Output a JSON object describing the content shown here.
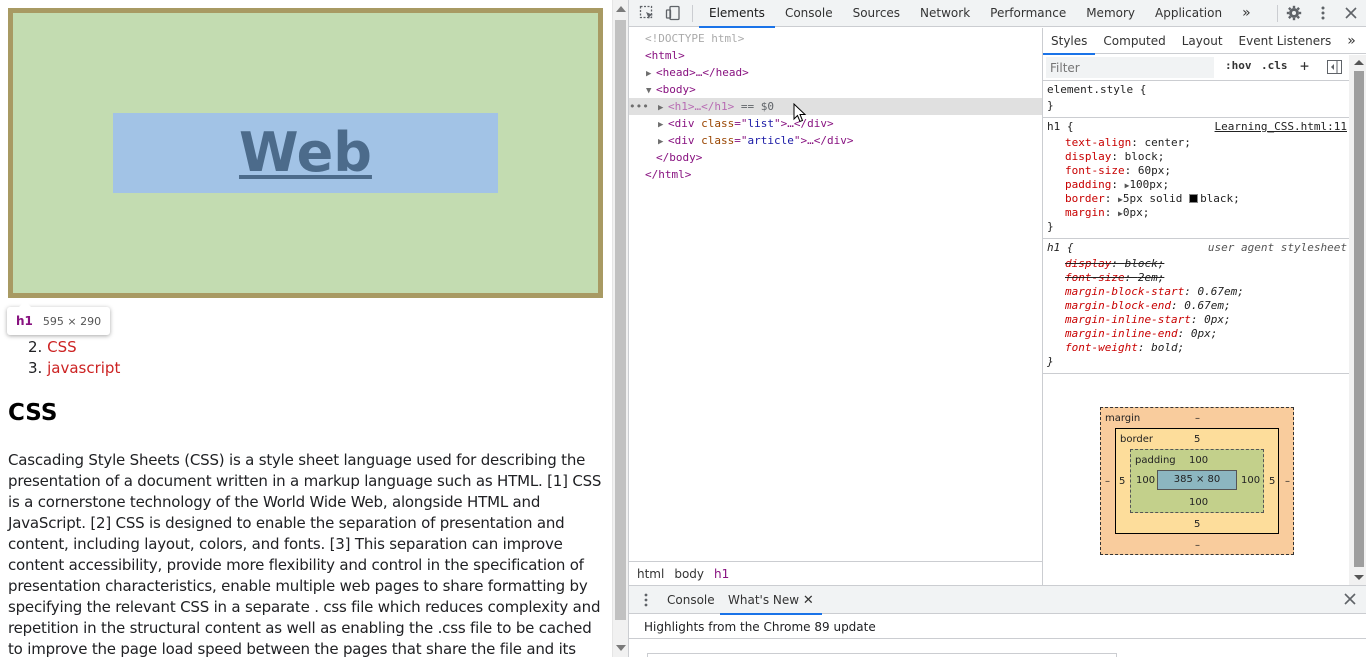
{
  "page": {
    "h1_text": "Web",
    "tooltip": {
      "tag": "h1",
      "dims": "595 × 290"
    },
    "list_items": [
      {
        "num": "2.",
        "label": "CSS"
      },
      {
        "num": "3.",
        "label": "javascript"
      }
    ],
    "article_heading": "CSS",
    "article_text": "Cascading Style Sheets (CSS) is a style sheet language used for describing the presentation of a document written in a markup language such as HTML. [1] CSS is a cornerstone technology of the World Wide Web, alongside HTML and JavaScript. [2] CSS is designed to enable the separation of presentation and content, including layout, colors, and fonts. [3] This separation can improve content accessibility, provide more flexibility and control in the specification of presentation characteristics, enable multiple web pages to share formatting by specifying the relevant CSS in a separate . css file which reduces complexity and repetition in the structural content as well as enabling the .css file to be cached to improve the page load speed between the pages that share the file and its"
  },
  "devtools": {
    "tabs": [
      "Elements",
      "Console",
      "Sources",
      "Network",
      "Performance",
      "Memory",
      "Application"
    ],
    "more_tabs": "»",
    "dom": {
      "doctype": "<!DOCTYPE html>",
      "html_open": "<html>",
      "head": "…</head>",
      "body_open": "<body>",
      "h1_line": "…</h1>",
      "h1_eq": "== $0",
      "div_list_class": "list",
      "div_article_class": "article",
      "body_close": "</body>",
      "html_close": "</html>",
      "dots": "•••"
    },
    "breadcrumb": [
      "html",
      "body",
      "h1"
    ],
    "styles_tabs": [
      "Styles",
      "Computed",
      "Layout",
      "Event Listeners",
      "»"
    ],
    "filter_placeholder": "Filter",
    "hov": ":hov",
    "cls": ".cls",
    "rules": {
      "element_style": "element.style {",
      "close": "}",
      "author_selector": "h1 {",
      "author_source": "Learning_CSS.html:11",
      "author_props": [
        {
          "name": "text-align",
          "value": "center;"
        },
        {
          "name": "display",
          "value": "block;"
        },
        {
          "name": "font-size",
          "value": "60px;"
        },
        {
          "name": "padding",
          "value": "100px;"
        },
        {
          "name": "border",
          "value": "5px solid",
          "value2": "black;"
        },
        {
          "name": "margin",
          "value": "0px;"
        }
      ],
      "ua_selector": "h1 {",
      "ua_source": "user agent stylesheet",
      "ua_props": [
        {
          "name": "display",
          "value": "block;"
        },
        {
          "name": "font-size",
          "value": "2em;"
        },
        {
          "name": "margin-block-start",
          "value": "0.67em;"
        },
        {
          "name": "margin-block-end",
          "value": "0.67em;"
        },
        {
          "name": "margin-inline-start",
          "value": "0px;"
        },
        {
          "name": "margin-inline-end",
          "value": "0px;"
        },
        {
          "name": "font-weight",
          "value": "bold;"
        }
      ]
    },
    "box_model": {
      "margin_label": "margin",
      "margin_value": "–",
      "border_label": "border",
      "border_value": "5",
      "padding_label": "padding",
      "padding_value": "100",
      "content": "385 × 80"
    },
    "drawer": {
      "tabs": [
        "Console",
        "What's New"
      ],
      "highlight": "Highlights from the Chrome 89 update"
    }
  },
  "colors": {
    "h1_bg": "#c3dcb1",
    "h1_border": "#a89a63",
    "h1_content": "#a2c3e6",
    "link": "#cc2222",
    "accent": "#1a73e8"
  }
}
